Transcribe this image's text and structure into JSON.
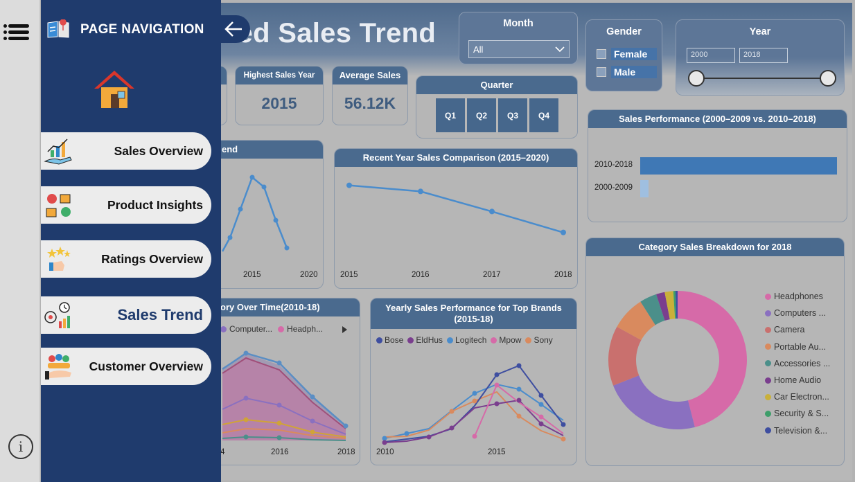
{
  "report": {
    "title_visible": "sed Sales Trend"
  },
  "kpis": [
    {
      "label": "Highest Sales Year",
      "value": "2015"
    },
    {
      "label": "Average Sales",
      "value": "56.12K"
    }
  ],
  "slicers": {
    "month": {
      "label": "Month",
      "selected": "All"
    },
    "gender": {
      "label": "Gender",
      "options": [
        "Female",
        "Male"
      ]
    },
    "year": {
      "label": "Year",
      "from": "2000",
      "to": "2018"
    },
    "quarter": {
      "label": "Quarter",
      "options": [
        "Q1",
        "Q2",
        "Q3",
        "Q4"
      ]
    }
  },
  "trend_card": {
    "title_visible": "end",
    "ticks": [
      "2015",
      "2020"
    ]
  },
  "recent_card": {
    "title": "Recent Year Sales Comparison (2015–2020)",
    "ticks": [
      "2015",
      "2016",
      "2017",
      "2018"
    ]
  },
  "perf_card": {
    "title": "Sales Performance (2000–2009 vs. 2010–2018)",
    "rows": [
      "2010-2018",
      "2000-2009"
    ]
  },
  "category_time_card": {
    "title_visible": "ory Over Time(2010-18)",
    "legend": [
      "Computer...",
      "Headph..."
    ],
    "ticks": [
      "4",
      "2016",
      "2018"
    ]
  },
  "brands_card": {
    "title": "Yearly Sales Performance for Top Brands (2015-18)",
    "legend": [
      "Bose",
      "EldHus",
      "Logitech",
      "Mpow",
      "Sony"
    ],
    "ticks": [
      "2010",
      "2015"
    ]
  },
  "pie_card": {
    "title": "Category Sales Breakdown for 2018",
    "legend": [
      "Headphones",
      "Computers ...",
      "Camera",
      "Portable Au...",
      "Accessories ...",
      "Home Audio",
      "Car Electron...",
      "Security & S...",
      "Television &..."
    ]
  },
  "navigation": {
    "title": "PAGE NAVIGATION",
    "items": [
      "Sales Overview",
      "Product Insights",
      "Ratings Overview",
      "Sales Trend",
      "Customer Overview"
    ],
    "active": "Sales Trend"
  },
  "colors": {
    "drawer": "#1f3b6d",
    "card_header": "#4a6a8e",
    "line": "#4a8ccc",
    "headphones": "#d66aa8",
    "computers": "#8a70c0",
    "camera": "#c9706e",
    "portable": "#d98a5e",
    "accessories": "#4b8f8a",
    "home_audio": "#7a3e8e",
    "car": "#c9b03a",
    "security": "#3e9e6a",
    "television": "#3e4ea0"
  },
  "chart_data": [
    {
      "type": "line",
      "title": "Recent Year Sales Comparison (2015–2020)",
      "x": [
        2015,
        2016,
        2017,
        2018
      ],
      "series": [
        {
          "values": [
            90,
            83,
            60,
            36
          ]
        }
      ],
      "xlabel": "",
      "ylabel": ""
    },
    {
      "type": "bar",
      "title": "Sales Performance (2000–2009 vs. 2010–2018)",
      "categories": [
        "2010-2018",
        "2000-2009"
      ],
      "values": [
        100,
        4
      ]
    },
    {
      "type": "pie",
      "title": "Category Sales Breakdown for 2018",
      "categories": [
        "Headphones",
        "Computers ...",
        "Camera",
        "Portable Au...",
        "Accessories ...",
        "Home Audio",
        "Car Electron...",
        "Security & S...",
        "Television &..."
      ],
      "values": [
        46,
        23,
        14,
        8,
        4,
        2,
        2,
        0.5,
        0.5
      ]
    }
  ]
}
